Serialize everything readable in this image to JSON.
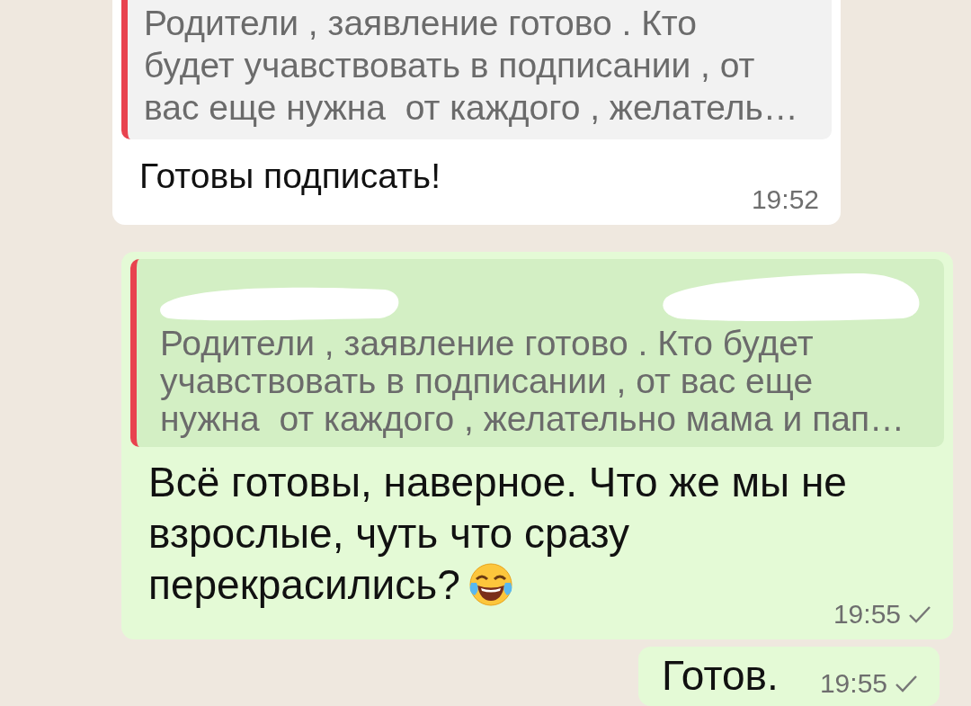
{
  "messages": [
    {
      "kind": "incoming",
      "quote": {
        "lines": [
          "Родители , заявление готово . Кто",
          "будет учавствовать в подписании , от",
          "вас еще нужна  от каждого , желатель…"
        ]
      },
      "text": "Готовы подписать!",
      "time": "19:52"
    },
    {
      "kind": "outgoing",
      "quote": {
        "author_hidden": true,
        "lines": [
          "Родители , заявление готово . Кто будет",
          "учавствовать в подписании , от вас еще",
          "нужна  от каждого , желательно мама и пап…"
        ]
      },
      "text": "Всё готовы, наверное. Что же мы не взрослые, чуть что сразу перекрасились?",
      "emoji": true,
      "time": "19:55",
      "sent": true
    },
    {
      "kind": "outgoing_short",
      "text": "Готов.",
      "time": "19:55",
      "sent": true
    }
  ]
}
